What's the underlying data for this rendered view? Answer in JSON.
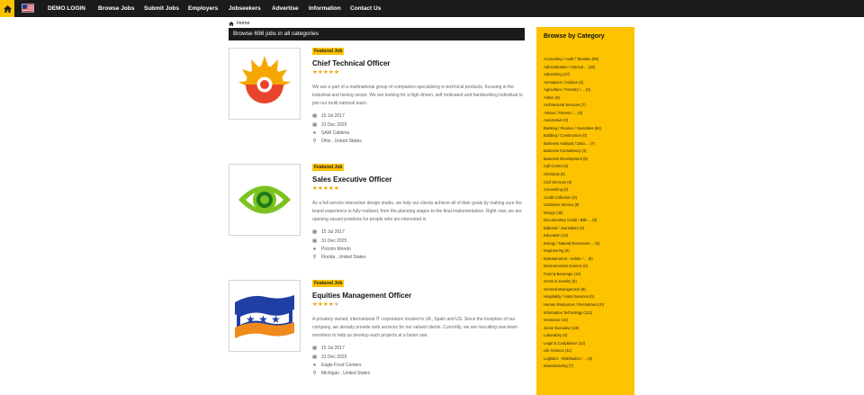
{
  "nav": {
    "items": [
      "DEMO LOGIN",
      "Browse Jobs",
      "Submit Jobs",
      "Employers",
      "Jobseekers",
      "Advertise",
      "Information",
      "Contact Us"
    ]
  },
  "breadcrumb": {
    "home": "Home"
  },
  "heading": "Browse 698 jobs in all categories",
  "jobs": [
    {
      "badge": "Featured Job",
      "title": "Chief Technical Officer",
      "rating": 5,
      "description": "We are a part of a multinational group of companies specializing in technical products, focusing in the industrial and mining sector. We are looking for a high driven, self motivated and hardworking individual to join our multi national team.",
      "posted": "15 Jul 2017",
      "expires": "31 Dec 2025",
      "company": "SAW Calderia",
      "location": "Ohio , United States"
    },
    {
      "badge": "Featured Job",
      "title": "Sales Executive Officer",
      "rating": 5,
      "description": "As a full service interactive design studio, we help our clients achieve all of their goals by making sure the brand experience is fully realised, from the planning stages to the final implementation. Right now, we are opening vacant positions for people who are interested in",
      "posted": "15 Jul 2017",
      "expires": "31 Dec 2025",
      "company": "Pizzolo Mondo",
      "location": "Florida , United States"
    },
    {
      "badge": "Featured Job",
      "title": "Equities Management Officer",
      "rating": 4,
      "description": "A privately owned, international IT corporation located in UK, Spain and US. Since the inception of our company, we already provide web services for our valued clients. Currently, we are recruiting new team members to help us develop each projects at a faster rate.",
      "posted": "15 Jul 2017",
      "expires": "31 Dec 2025",
      "company": "Eagle Food Centers",
      "location": "Michigan , United States"
    }
  ],
  "sidebar": {
    "title": "Browse by Category",
    "categories": [
      "Accounting / Audit / Taxation (69)",
      "Administration / Clerical ... (28)",
      "Advertising (27)",
      "Aerospace / Aviation (0)",
      "Agriculture / Forestry / ... (0)",
      "Airline (0)",
      "Architectural Services (7)",
      "Artisan / Fitness / ... (0)",
      "Automotive (0)",
      "Banking / Finance / Securities (62)",
      "Building / Construction (0)",
      "Business Analysis / Data ... (7)",
      "Business Consultancy (4)",
      "Business Development (8)",
      "Call Centre (0)",
      "Chemical (0)",
      "Civil Services (0)",
      "Counseling (0)",
      "Credit Collection (0)",
      "Customer Service (9)",
      "Design (48)",
      "Documentary Credit / Bills ... (0)",
      "Editorial / Journalism (0)",
      "Education (12)",
      "Energy / Natural Resources ... (0)",
      "Engineering (0)",
      "Entertainment - Artiste / ... (0)",
      "Environmental Science (0)",
      "Food & Beverage (10)",
      "Gems & Jewelry (0)",
      "General Management (9)",
      "Hospitality / Hotel Services (0)",
      "Human Resources / Recruitment (0)",
      "Information Technology (113)",
      "Insurance (10)",
      "Junior Executive (28)",
      "Laboratory (0)",
      "Legal & Compliance (12)",
      "Life Science (11)",
      "Logistics - Distribution / ... (0)",
      "Manufacturing (7)"
    ]
  }
}
